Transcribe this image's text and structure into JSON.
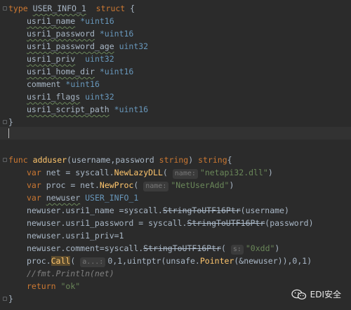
{
  "struct_block": {
    "line1": {
      "kw": "type",
      "name": "USER_INFO_1",
      "kw2": "struct",
      "brace": "{"
    },
    "fields": [
      {
        "name": "usri1_name",
        "type": "*uint16"
      },
      {
        "name": "usri1_password",
        "type": "*uint16"
      },
      {
        "name": "usri1_password_age",
        "type": "uint32"
      },
      {
        "name": "usri1_priv",
        "type": "uint32"
      },
      {
        "name": "usri1_home_dir",
        "type": "*uint16"
      },
      {
        "name": "comment",
        "type": "*uint16"
      },
      {
        "name": "usri1_flags",
        "type": "uint32"
      },
      {
        "name": "usri1_script_path",
        "type": "*uint16"
      }
    ],
    "close": "}"
  },
  "func_block": {
    "sig": {
      "kw": "func",
      "name": "adduser",
      "params": "(username,password",
      "ptype": "string",
      "rparen": ")",
      "rtype": "string",
      "brace": "{"
    },
    "l1": {
      "kw": "var",
      "rest": "net = syscall.",
      "fn": "NewLazyDLL",
      "open": "(",
      "hint": "name:",
      "arg": "\"netapi32.dll\"",
      "close": ")"
    },
    "l2": {
      "kw": "var",
      "rest": "proc = net.",
      "fn": "NewProc",
      "open": "(",
      "hint": "name:",
      "arg": "\"NetUserAdd\"",
      "close": ")"
    },
    "l3": {
      "kw": "var",
      "var": "newuser",
      "type": "USER_INFO_1"
    },
    "l4": {
      "pre": "newuser.usri1_name =syscall.",
      "fn": "StringToUTF16Ptr",
      "post": "(username)"
    },
    "l5": {
      "pre": "newuser.usri1_password = syscall.",
      "fn": "StringToUTF16Ptr",
      "post": "(password)"
    },
    "l6": {
      "pre": "newuser.usri1_priv=1"
    },
    "l7": {
      "pre": "newuser.comment=syscall.",
      "fn": "StringToUTF16Ptr",
      "open": "(",
      "hint": "s:",
      "arg": "\"0xdd\"",
      "close": ")"
    },
    "l8": {
      "pre": "proc.",
      "fn": "Call",
      "open": "(",
      "hint": "a...:",
      "post": "0,1,uintptr(unsafe.",
      "fn2": "Pointer",
      "post2": "(&newuser)),0,1)"
    },
    "l9": {
      "cmt": "//fmt.Println(net)"
    },
    "l10": {
      "kw": "return",
      "arg": "\"ok\""
    },
    "close": "}"
  },
  "brand": {
    "label": "EDI安全",
    "icon": "wechat-icon"
  }
}
